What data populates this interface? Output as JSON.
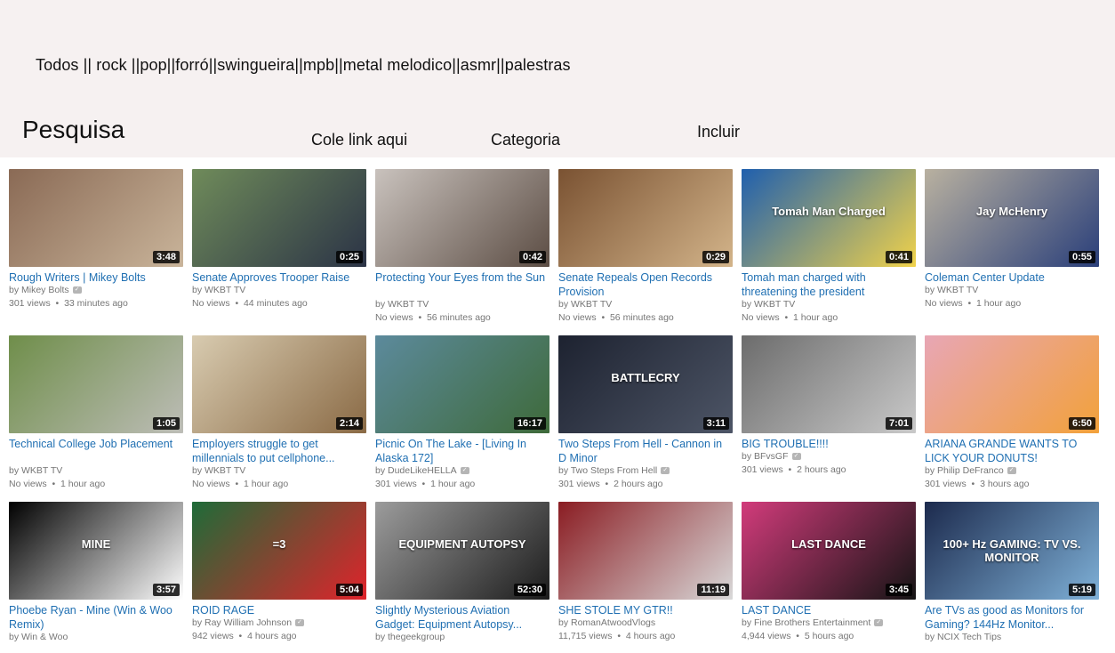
{
  "header": {
    "categories_text": "Todos || rock ||pop||forró||swingueira||mpb||metal melodico||asmr||palestras",
    "search_label": "Pesquisa",
    "paste_link_label": "Cole link aqui",
    "category_label": "Categoria",
    "include_label": "Incluir"
  },
  "videos": [
    {
      "title": "Rough Writers | Mikey Bolts",
      "channel": "by Mikey Bolts",
      "verified": true,
      "views": "301 views",
      "age": "33 minutes ago",
      "duration": "3:48",
      "thumb_color": "#8a6a55",
      "thumb_color2": "#c9b49a",
      "overlay": ""
    },
    {
      "title": "Senate Approves Trooper Raise",
      "channel": "by WKBT TV",
      "verified": false,
      "views": "No views",
      "age": "44 minutes ago",
      "duration": "0:25",
      "thumb_color": "#6f8b5a",
      "thumb_color2": "#2b3346",
      "overlay": ""
    },
    {
      "title": "Protecting Your Eyes from the Sun",
      "channel": "by WKBT TV",
      "verified": false,
      "views": "No views",
      "age": "56 minutes ago",
      "duration": "0:42",
      "thumb_color": "#c9c2bd",
      "thumb_color2": "#5c4d44",
      "overlay": ""
    },
    {
      "title": "Senate Repeals Open Records Provision",
      "channel": "by WKBT TV",
      "verified": false,
      "views": "No views",
      "age": "56 minutes ago",
      "duration": "0:29",
      "thumb_color": "#7a5232",
      "thumb_color2": "#d3b48a",
      "overlay": ""
    },
    {
      "title": "Tomah man charged with threatening the president",
      "channel": "by WKBT TV",
      "verified": false,
      "views": "No views",
      "age": "1 hour ago",
      "duration": "0:41",
      "thumb_color": "#1f5fae",
      "thumb_color2": "#f0d24a",
      "overlay": "Tomah Man Charged"
    },
    {
      "title": "Coleman Center Update",
      "channel": "by WKBT TV",
      "verified": false,
      "views": "No views",
      "age": "1 hour ago",
      "duration": "0:55",
      "thumb_color": "#b9b1a0",
      "thumb_color2": "#2a3f7a",
      "overlay": "Jay McHenry"
    },
    {
      "title": "Technical College Job Placement",
      "channel": "by WKBT TV",
      "verified": false,
      "views": "No views",
      "age": "1 hour ago",
      "duration": "1:05",
      "thumb_color": "#6f8e4a",
      "thumb_color2": "#bdbdb7",
      "overlay": ""
    },
    {
      "title": "Employers struggle to get millennials to put cellphone...",
      "channel": "by WKBT TV",
      "verified": false,
      "views": "No views",
      "age": "1 hour ago",
      "duration": "2:14",
      "thumb_color": "#d8cbb0",
      "thumb_color2": "#8a6a45",
      "overlay": ""
    },
    {
      "title": "Picnic On The Lake - [Living In Alaska 172]",
      "channel": "by DudeLikeHELLA",
      "verified": true,
      "views": "301 views",
      "age": "1 hour ago",
      "duration": "16:17",
      "thumb_color": "#5c8a9c",
      "thumb_color2": "#3e6a3a",
      "overlay": ""
    },
    {
      "title": "Two Steps From Hell - Cannon in D Minor",
      "channel": "by Two Steps From Hell",
      "verified": true,
      "views": "301 views",
      "age": "2 hours ago",
      "duration": "3:11",
      "thumb_color": "#1d2230",
      "thumb_color2": "#4d5566",
      "overlay": "BATTLECRY"
    },
    {
      "title": "BIG TROUBLE!!!!",
      "channel": "by BFvsGF",
      "verified": true,
      "views": "301 views",
      "age": "2 hours ago",
      "duration": "7:01",
      "thumb_color": "#6c6c6c",
      "thumb_color2": "#c9c9c9",
      "overlay": ""
    },
    {
      "title": "ARIANA GRANDE WANTS TO LICK YOUR DONUTS!",
      "channel": "by Philip DeFranco",
      "verified": true,
      "views": "301 views",
      "age": "3 hours ago",
      "duration": "6:50",
      "thumb_color": "#e8a6b5",
      "thumb_color2": "#f2a13a",
      "overlay": ""
    },
    {
      "title": "Phoebe Ryan - Mine (Win & Woo Remix)",
      "channel": "by Win & Woo",
      "verified": false,
      "views": "",
      "age": "",
      "duration": "3:57",
      "thumb_color": "#000000",
      "thumb_color2": "#ffffff",
      "overlay": "MINE"
    },
    {
      "title": "ROID RAGE",
      "channel": "by Ray William Johnson",
      "verified": true,
      "views": "942 views",
      "age": "4 hours ago",
      "duration": "5:04",
      "thumb_color": "#1e6b38",
      "thumb_color2": "#e0232b",
      "overlay": "=3"
    },
    {
      "title": "Slightly Mysterious Aviation Gadget: Equipment Autopsy...",
      "channel": "by thegeekgroup",
      "verified": false,
      "views": "",
      "age": "",
      "duration": "52:30",
      "thumb_color": "#9c9c9c",
      "thumb_color2": "#1b1b1b",
      "overlay": "EQUIPMENT AUTOPSY"
    },
    {
      "title": "SHE STOLE MY GTR!!",
      "channel": "by RomanAtwoodVlogs",
      "verified": false,
      "views": "11,715 views",
      "age": "4 hours ago",
      "duration": "11:19",
      "thumb_color": "#8a1c22",
      "thumb_color2": "#d9d9d9",
      "overlay": ""
    },
    {
      "title": "LAST DANCE",
      "channel": "by Fine Brothers Entertainment",
      "verified": true,
      "views": "4,944 views",
      "age": "5 hours ago",
      "duration": "3:45",
      "thumb_color": "#d23b7b",
      "thumb_color2": "#141414",
      "overlay": "LAST DANCE"
    },
    {
      "title": "Are TVs as good as Monitors for Gaming? 144Hz Monitor...",
      "channel": "by NCIX Tech Tips",
      "verified": false,
      "views": "",
      "age": "",
      "duration": "5:19",
      "thumb_color": "#1c2a4d",
      "thumb_color2": "#7fb1d8",
      "overlay": "100+ Hz GAMING: TV VS. MONITOR"
    }
  ]
}
